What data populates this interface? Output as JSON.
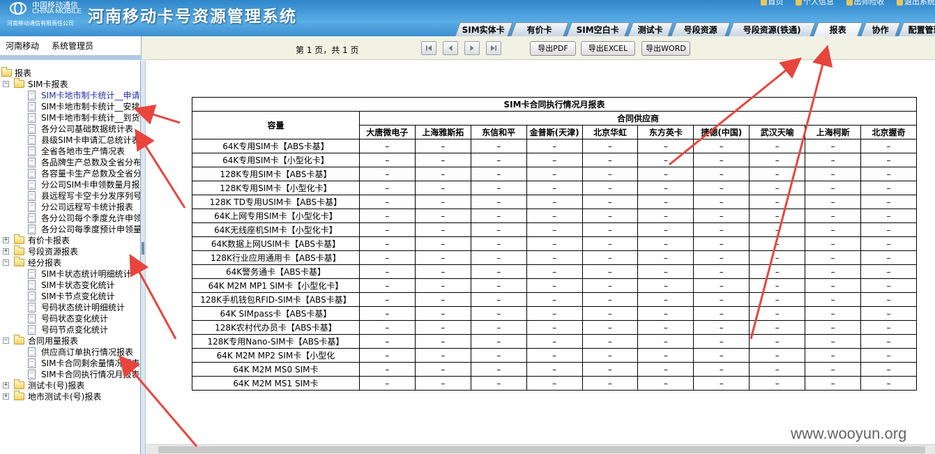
{
  "header": {
    "logo_cn": "中国移动通信",
    "logo_en": "CHINA MOBILE",
    "logo_sub": "河南移动通信有限责任公司",
    "title": "河南移动卡号资源管理系统",
    "top_links": [
      "首页",
      "个人信息",
      "出师险收",
      "退出系统"
    ],
    "brand_color": "#3d8fd0"
  },
  "tabs": [
    "SIM实体卡",
    "有价卡",
    "SIM空白卡",
    "测试卡",
    "号段资源",
    "号段资源(铁通)",
    "报表",
    "协作",
    "配置管理"
  ],
  "active_tab": "报表",
  "user": {
    "org": "河南移动",
    "role": "系统管理员"
  },
  "pager": {
    "text": "第 1 页，共 1 页",
    "export_pdf": "导出PDF",
    "export_excel": "导出EXCEL",
    "export_word": "导出WORD"
  },
  "tree": {
    "root": "报表",
    "sim_group": "SIM卡报表",
    "sim_items": [
      "SIM卡地市制卡统计__申请",
      "SIM卡地市制卡统计__安排",
      "SIM卡地市制卡统计__到货",
      "各分公司基础数据统计表",
      "县级SIM卡申请汇总统计表",
      "全省各地市生产情况表",
      "各品牌生产总数及全省分布",
      "各容量卡生产总数及全省分布",
      "分公司SIM卡申领数量月报",
      "县远程写卡空卡分发序列号",
      "分公司远程写卡统计报表",
      "各分公司每个季度允许申领",
      "各分公司每季度预计申领量"
    ],
    "group_prepaid": "有价卡报表",
    "group_segment": "号段资源报表",
    "group_business": "经分报表",
    "business_items": [
      "SIM卡状态统计明细统计",
      "SIM卡状态变化统计",
      "SIM卡节点变化统计",
      "号码状态统计明细统计",
      "号码状态变化统计",
      "号码节点变化统计"
    ],
    "group_contract": "合同用量报表",
    "contract_items": [
      "供应商订单执行情况报表",
      "SIM卡合同剩余量情况报表",
      "SIM卡合同执行情况月报表"
    ],
    "group_test": "测试卡(号)报表",
    "group_city_test": "地市测试卡(号)报表"
  },
  "report": {
    "title": "SIM卡合同执行情况月报表",
    "col_capacity": "容量",
    "col_suppliers_group": "合同供应商",
    "suppliers": [
      "大唐微电子",
      "上海雅斯拓",
      "东信和平",
      "金普斯(天津)",
      "北京华虹",
      "东方英卡",
      "捷德(中国)",
      "武汉天喻",
      "上海柯斯",
      "北京握奇"
    ],
    "rows": [
      "64K专用SIM卡【ABS卡基】",
      "64K专用SIM卡【小型化卡】",
      "128K专用SIM卡【ABS卡基】",
      "128K专用SIM卡【小型化卡】",
      "128K TD专用USIM卡【ABS卡基】",
      "64K上网专用SIM卡【小型化卡】",
      "64K无线座机SIM卡【小型化卡】",
      "64K数据上网USIM卡【ABS卡基】",
      "128K行业应用通用卡【ABS卡基】",
      "64K警务通卡【ABS卡基】",
      "64K M2M MP1 SIM卡【小型化卡】",
      "128K手机钱包RFID-SIM卡【ABS卡基】",
      "64K SIMpass卡【ABS卡基】",
      "128K农村代办员卡【ABS卡基】",
      "128K专用Nano-SIM卡【ABS卡基】",
      "64K M2M MP2 SIM卡【小型化",
      "64K M2M MS0 SIM卡",
      "64K M2M MS1 SIM卡"
    ],
    "empty_value": "–"
  },
  "watermark": "www.wooyun.org",
  "annotation_color": "#e8453c"
}
